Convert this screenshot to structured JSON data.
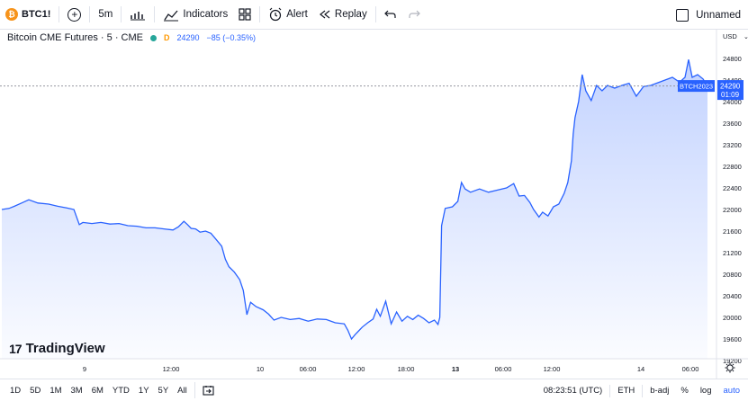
{
  "toolbar": {
    "symbol_icon": "bitcoin-icon",
    "symbol": "BTC1!",
    "interval": "5m",
    "indicators_label": "Indicators",
    "alert_label": "Alert",
    "replay_label": "Replay",
    "layout_name": "Unnamed"
  },
  "legend": {
    "title": "Bitcoin CME Futures · 5 · CME",
    "badge": "D",
    "last": "24290",
    "change": "−85 (−0.35%)"
  },
  "brand": {
    "logo": "17",
    "name": "TradingView"
  },
  "price_axis": {
    "currency": "USD",
    "last_symbol": "BTCH2023",
    "last_price": "24290",
    "countdown": "01:09"
  },
  "colors": {
    "line": "#2962ff",
    "accent": "#2962ff",
    "symbol_icon": "#f7931a"
  },
  "chart_data": {
    "type": "area",
    "series": [
      {
        "x": [
          0,
          8,
          14,
          22,
          30,
          40,
          52,
          62,
          72,
          80,
          86,
          90,
          100,
          110,
          120,
          130,
          140,
          150,
          160,
          170,
          180,
          190,
          196,
          202,
          206,
          210,
          215,
          220,
          226,
          232,
          238,
          244,
          248,
          252,
          258,
          264,
          268,
          272,
          276,
          282,
          290,
          296,
          302,
          310,
          320,
          330,
          340,
          350,
          360,
          370,
          380,
          384,
          388,
          392,
          396,
          400,
          406,
          412,
          416,
          420,
          426,
          432,
          438,
          444,
          450,
          456,
          462,
          468,
          474,
          480,
          484,
          486,
          488,
          492,
          500,
          506,
          510,
          514,
          520,
          530,
          540,
          550,
          560,
          568,
          574,
          580,
          586,
          590,
          596,
          600,
          606,
          612,
          618,
          624,
          628,
          632,
          634,
          636,
          640,
          644,
          648,
          654,
          660,
          666,
          672,
          680,
          688,
          696,
          704,
          712,
          720,
          728,
          736,
          744,
          752,
          758,
          762,
          766,
          772,
          778,
          783
        ],
        "y": [
          22000,
          22020,
          22060,
          22120,
          22180,
          22120,
          22100,
          22060,
          22030,
          22000,
          21720,
          21760,
          21740,
          21760,
          21730,
          21740,
          21700,
          21690,
          21660,
          21660,
          21640,
          21620,
          21680,
          21780,
          21720,
          21650,
          21640,
          21580,
          21600,
          21560,
          21440,
          21320,
          21080,
          20940,
          20840,
          20700,
          20500,
          20050,
          20280,
          20200,
          20140,
          20060,
          19950,
          20000,
          19960,
          19980,
          19930,
          19970,
          19960,
          19900,
          19880,
          19760,
          19600,
          19680,
          19750,
          19820,
          19900,
          19970,
          20150,
          20020,
          20300,
          19880,
          20100,
          19930,
          20020,
          19960,
          20040,
          19980,
          19900,
          19950,
          19870,
          20000,
          21700,
          22020,
          22050,
          22150,
          22500,
          22380,
          22320,
          22380,
          22320,
          22360,
          22400,
          22480,
          22250,
          22260,
          22130,
          22000,
          21860,
          21950,
          21880,
          22050,
          22100,
          22300,
          22500,
          22900,
          23400,
          23700,
          24000,
          24500,
          24200,
          24020,
          24300,
          24200,
          24300,
          24250,
          24300,
          24340,
          24100,
          24280,
          24300,
          24350,
          24400,
          24450,
          24360,
          24450,
          24780,
          24450,
          24500,
          24420,
          24290
        ]
      }
    ],
    "ylim": [
      19200,
      25200
    ],
    "yticks": [
      "24800",
      "24400",
      "24000",
      "23600",
      "23200",
      "22800",
      "22400",
      "22000",
      "21600",
      "21200",
      "20800",
      "20400",
      "20000",
      "19600",
      "19200"
    ],
    "xtick_labels": [
      "9",
      "12:00",
      "10",
      "06:00",
      "12:00",
      "18:00",
      "13",
      "06:00",
      "12:00",
      "14",
      "06:00"
    ],
    "last_value": 24290,
    "grid": false
  },
  "bottom": {
    "ranges": [
      "1D",
      "5D",
      "1M",
      "3M",
      "6M",
      "YTD",
      "1Y",
      "5Y",
      "All"
    ],
    "time": "08:23:51 (UTC)",
    "session": "ETH",
    "badj": "b-adj",
    "percent": "%",
    "log": "log",
    "auto": "auto"
  }
}
